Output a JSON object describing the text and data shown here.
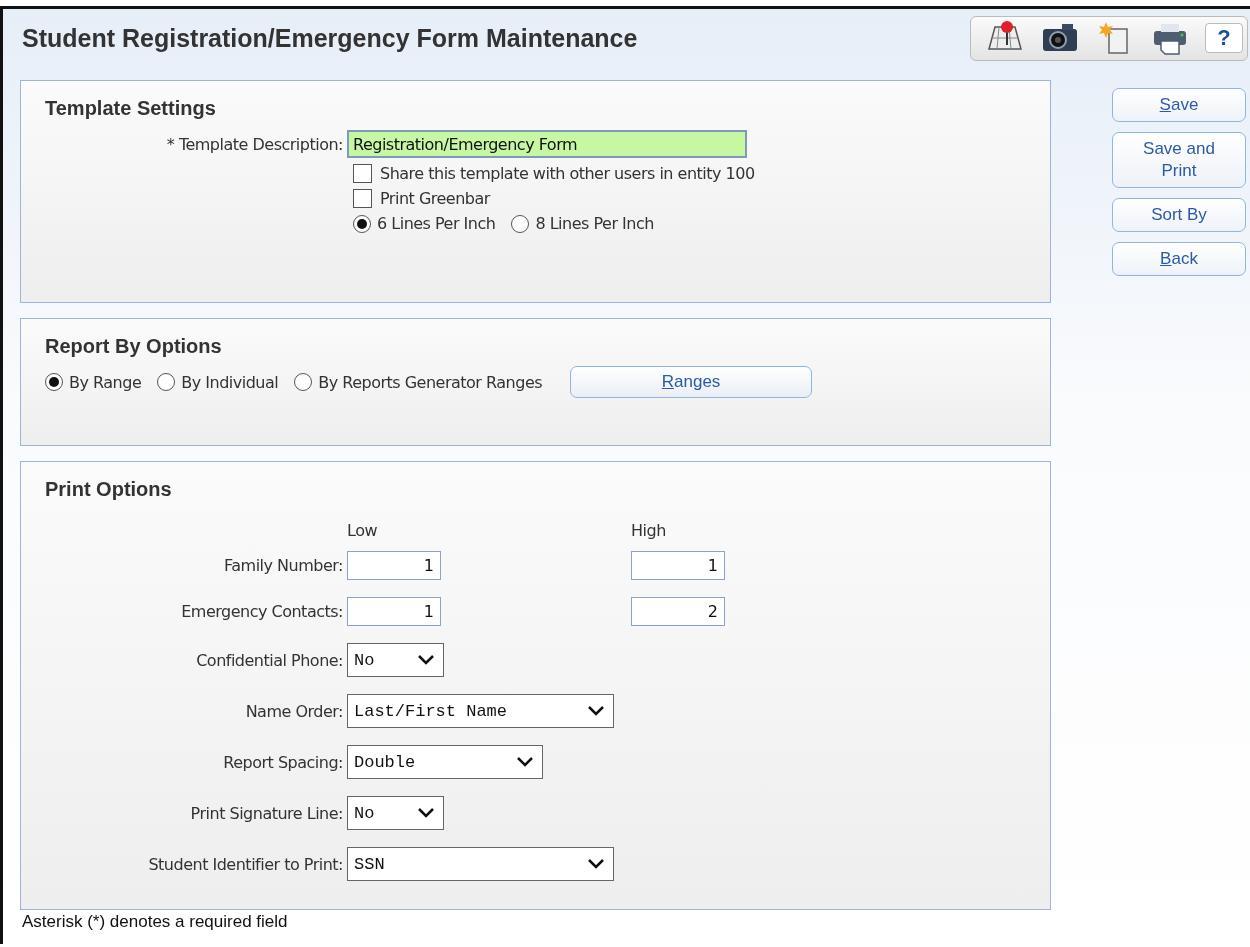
{
  "title": "Student Registration/Emergency Form Maintenance",
  "toolbar": [
    {
      "kind": "map"
    },
    {
      "kind": "camera"
    },
    {
      "kind": "new-page"
    },
    {
      "kind": "printer"
    },
    {
      "kind": "help",
      "label": "?"
    }
  ],
  "actions": [
    {
      "label": "Save",
      "underline_first": true
    },
    {
      "label": "Save and Print",
      "underline_first": false
    },
    {
      "label": "Sort By",
      "underline_first": false
    },
    {
      "label": "Back",
      "underline_first": true
    }
  ],
  "template_settings": {
    "heading": "Template Settings",
    "description": {
      "label": "* Template Description:",
      "value": "Registration/Emergency Form"
    },
    "checkboxes": [
      {
        "label": "Share this template with other users in entity 100",
        "checked": false
      },
      {
        "label": "Print Greenbar",
        "checked": false
      }
    ],
    "lines_per_inch": [
      {
        "label": "6 Lines Per Inch",
        "selected": true
      },
      {
        "label": "8 Lines Per Inch",
        "selected": false
      }
    ]
  },
  "report_by": {
    "heading": "Report By Options",
    "options": [
      {
        "label": "By Range",
        "selected": true
      },
      {
        "label": "By Individual",
        "selected": false
      },
      {
        "label": "By Reports Generator Ranges",
        "selected": false
      }
    ],
    "ranges_button": {
      "label": "Ranges",
      "underline_first": true
    }
  },
  "print_options": {
    "heading": "Print Options",
    "columns": [
      "Low",
      "High"
    ],
    "fields": [
      {
        "kind": "range",
        "label": "Family Number:",
        "low": "1",
        "high": "1"
      },
      {
        "kind": "range",
        "label": "Emergency Contacts:",
        "low": "1",
        "high": "2"
      },
      {
        "kind": "select",
        "label": "Confidential Phone:",
        "value": "No"
      },
      {
        "kind": "select",
        "label": "Name Order:",
        "value": "Last/First Name"
      },
      {
        "kind": "select",
        "label": "Report Spacing:",
        "value": "Double"
      },
      {
        "kind": "select",
        "label": "Print Signature Line:",
        "value": "No"
      },
      {
        "kind": "select",
        "label": "Student Identifier to Print:",
        "value": "SSN"
      }
    ]
  },
  "footnote": "Asterisk (*) denotes a required field"
}
